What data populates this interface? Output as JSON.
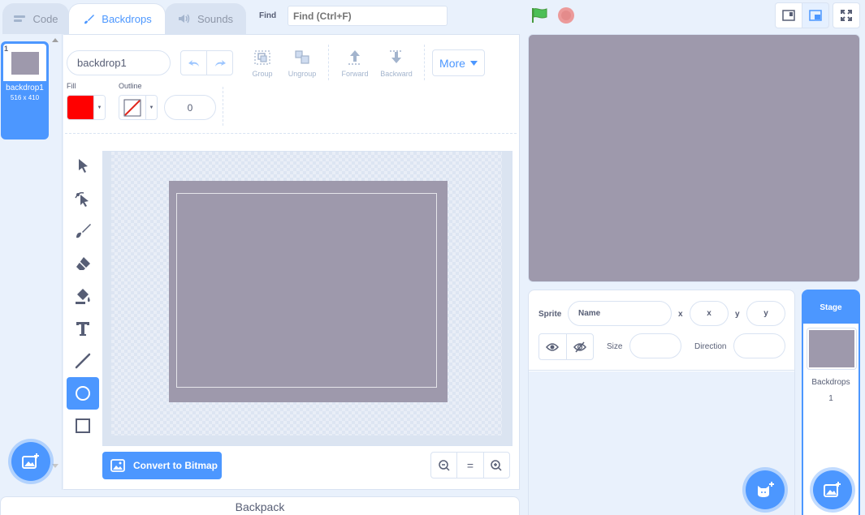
{
  "tabs": {
    "code": "Code",
    "backdrops": "Backdrops",
    "sounds": "Sounds"
  },
  "find": {
    "label": "Find",
    "placeholder": "Find (Ctrl+F)"
  },
  "costumes": [
    {
      "number": "1",
      "name": "backdrop1",
      "size": "516 x 410"
    }
  ],
  "paint": {
    "name_value": "backdrop1",
    "group": "Group",
    "ungroup": "Ungroup",
    "forward": "Forward",
    "backward": "Backward",
    "more": "More",
    "fill_label": "Fill",
    "outline_label": "Outline",
    "fill_color": "#ff0000",
    "stroke_width": "0",
    "tools": [
      "select-tool-icon",
      "reshape-tool-icon",
      "brush-tool-icon",
      "eraser-tool-icon",
      "fill-tool-icon",
      "text-tool-icon",
      "line-tool-icon",
      "circle-tool-icon",
      "rectangle-tool-icon"
    ],
    "active_tool": "circle-tool-icon",
    "convert_button": "Convert to Bitmap",
    "zoom_reset": "="
  },
  "backpack": "Backpack",
  "sprite_info": {
    "sprite_label": "Sprite",
    "name_placeholder": "Name",
    "x_label": "x",
    "x_placeholder": "x",
    "y_label": "y",
    "y_placeholder": "y",
    "size_label": "Size",
    "direction_label": "Direction"
  },
  "stage_selector": {
    "title": "Stage",
    "backdrops_label": "Backdrops",
    "backdrops_count": "1"
  },
  "colors": {
    "accent": "#4c97ff",
    "backdrop": "#9e99ac",
    "flag": "#4cbf56",
    "stop": "#ec9a9a"
  }
}
